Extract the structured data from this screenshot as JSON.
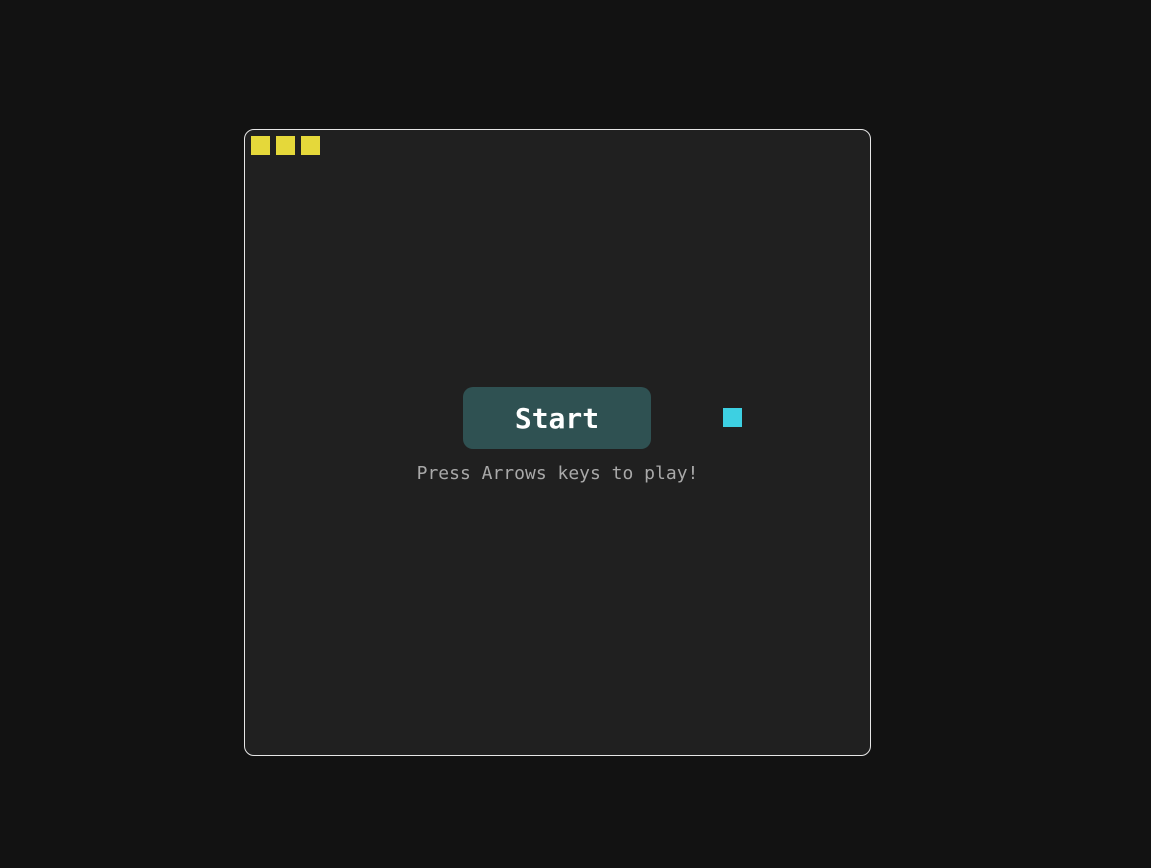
{
  "game": {
    "lives_count": 3,
    "start_label": "Start",
    "hint": "Press Arrows keys to play!"
  },
  "colors": {
    "life": "#e5d83a",
    "food": "#3dd0e2",
    "button_bg": "#2f5152"
  }
}
